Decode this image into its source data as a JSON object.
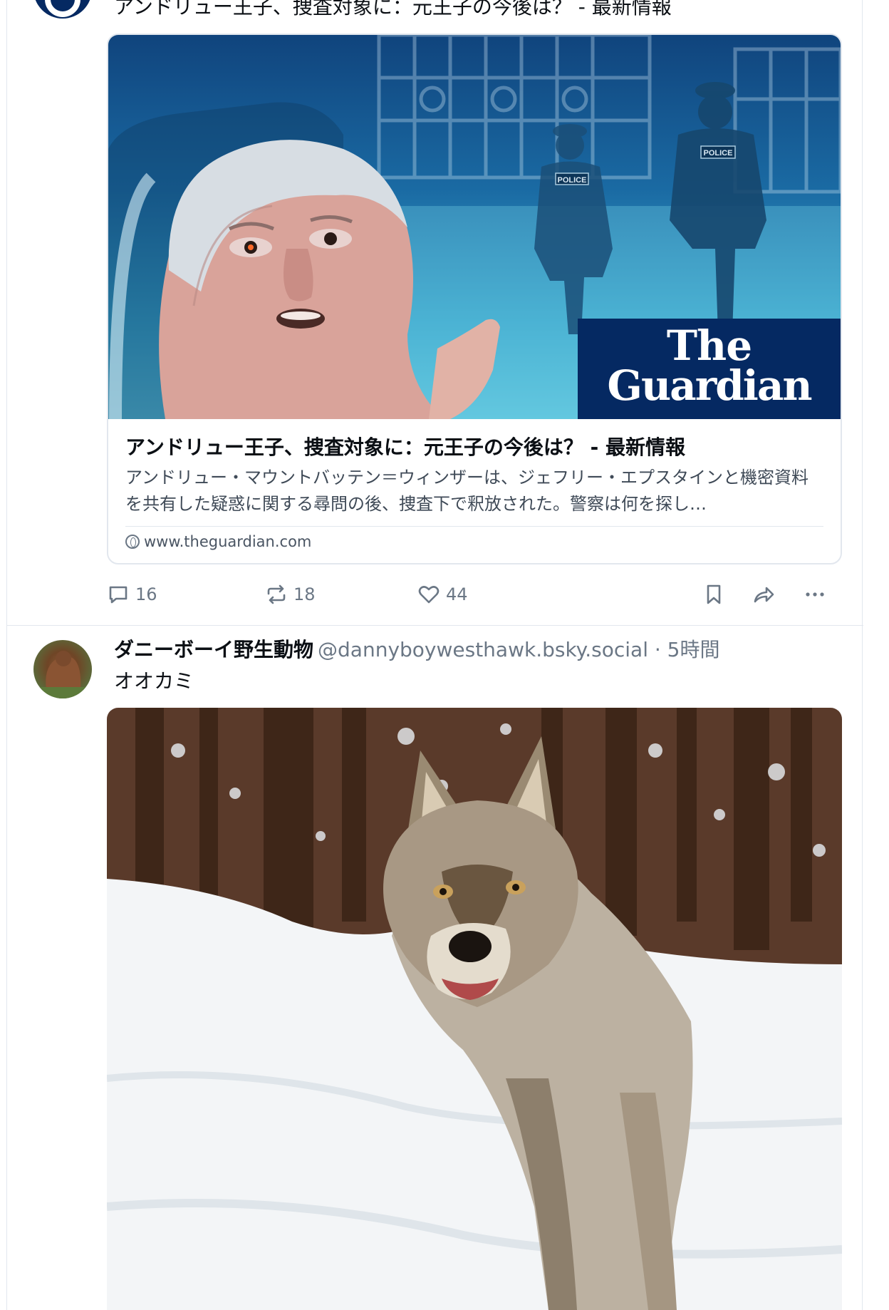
{
  "post1": {
    "text": "アンドリュー王子、捜査対象に：元王子の今後は？ - 最新情報",
    "card": {
      "logo_line1": "The",
      "logo_line2": "Guardian",
      "badge_left": "POLICE",
      "badge_right": "POLICE",
      "title": "アンドリュー王子、捜査対象に：元王子の今後は？ - 最新情報",
      "description": "アンドリュー・マウントバッテン＝ウィンザーは、ジェフリー・エプスタインと機密資料を共有した疑惑に関する尋問の後、捜査下で釈放された。警察は何を探し…",
      "domain": "www.theguardian.com"
    },
    "actions": {
      "replies": "16",
      "reposts": "18",
      "likes": "44"
    }
  },
  "post2": {
    "author_name": "ダニーボーイ野生動物",
    "author_handle": "@dannyboywesthawk.bsky.social",
    "time": " · 5時間",
    "text": "オオカミ"
  },
  "colors": {
    "text": "#0b0f14",
    "muted": "#6b7785",
    "border": "#e2e7ee",
    "guardian_navy": "#052962"
  },
  "icons": {
    "reply": "speech-bubble-icon",
    "repost": "repost-icon",
    "like": "heart-icon",
    "bookmark": "bookmark-icon",
    "share": "share-arrow-icon",
    "more": "ellipsis-icon",
    "domain": "globe-icon"
  }
}
